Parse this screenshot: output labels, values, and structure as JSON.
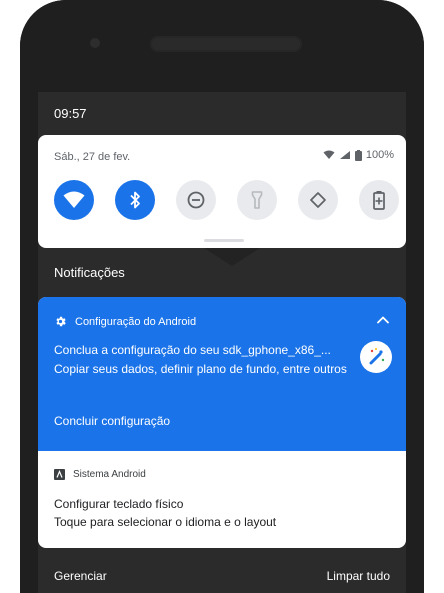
{
  "status_bar": {
    "time": "09:57"
  },
  "quick_settings": {
    "date": "Sáb., 27 de fev.",
    "battery": "100%",
    "tiles": [
      {
        "name": "wifi",
        "state": "on",
        "icon": "wifi-icon"
      },
      {
        "name": "bluetooth",
        "state": "on",
        "icon": "bluetooth-icon"
      },
      {
        "name": "do-not-disturb",
        "state": "off",
        "icon": "dnd-icon"
      },
      {
        "name": "flashlight",
        "state": "off",
        "icon": "flashlight-icon"
      },
      {
        "name": "auto-rotate",
        "state": "off",
        "icon": "rotate-icon"
      },
      {
        "name": "battery-saver",
        "state": "off",
        "icon": "battery-saver-icon"
      }
    ]
  },
  "notifications": {
    "title": "Notificações",
    "items": [
      {
        "app_name": "Configuração do Android",
        "title": "Conclua a configuração do seu sdk_gphone_x86_...",
        "text": "Copiar seus dados, definir plano de fundo, entre outros",
        "action": "Concluir configuração"
      },
      {
        "app_name": "Sistema Android",
        "title": "Configurar teclado físico",
        "text": "Toque para selecionar o idioma e o layout"
      }
    ],
    "footer": {
      "manage": "Gerenciar",
      "clear_all": "Limpar tudo"
    }
  },
  "colors": {
    "accent": "#1a73e8",
    "shade_bg": "#2b2b2b",
    "tile_off": "#e8eaed"
  }
}
